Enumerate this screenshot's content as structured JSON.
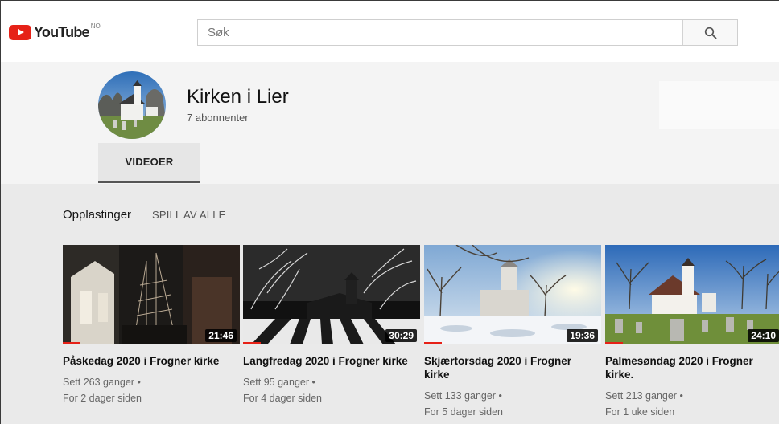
{
  "header": {
    "logo_text": "YouTube",
    "region": "NO",
    "search_placeholder": "Søk"
  },
  "channel": {
    "title": "Kirken i Lier",
    "subscribers": "7 abonnenter",
    "tabs": [
      {
        "label": "VIDEOER"
      }
    ]
  },
  "uploads": {
    "section_title": "Opplastinger",
    "play_all": "SPILL AV ALLE",
    "videos": [
      {
        "title": "Påskedag 2020 i Frogner kirke",
        "views": "Sett 263 ganger",
        "age": "For 2 dager siden",
        "duration": "21:46",
        "watched": 0.1
      },
      {
        "title": "Langfredag 2020 i Frogner kirke",
        "views": "Sett 95 ganger",
        "age": "For 4 dager siden",
        "duration": "30:29",
        "watched": 0.1
      },
      {
        "title": "Skjærtorsdag 2020 i Frogner kirke",
        "views": "Sett 133 ganger",
        "age": "For 5 dager siden",
        "duration": "19:36",
        "watched": 0.1
      },
      {
        "title": "Palmesøndag 2020 i Frogner kirke.",
        "views": "Sett 213 ganger",
        "age": "For 1 uke siden",
        "duration": "24:10",
        "watched": 0.1
      }
    ]
  },
  "colors": {
    "brand_red": "#e62117",
    "header_bg": "#f4f4f4",
    "content_bg": "#eaeaea"
  }
}
